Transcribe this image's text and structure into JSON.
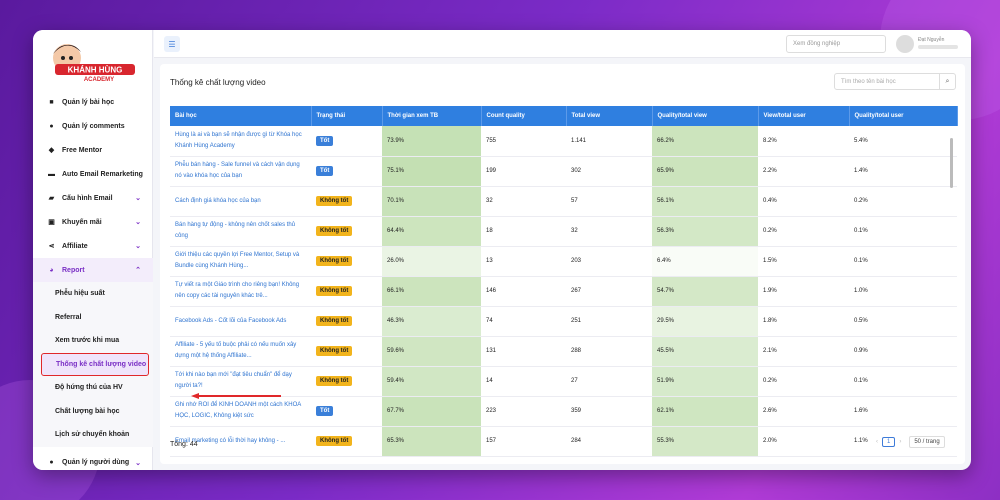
{
  "app": {
    "brand": "KHÁNH HÙNG ACADEMY"
  },
  "topbar": {
    "search_placeholder": "Xem đồng nghiệp",
    "user_name": "Đạt Nguyễn"
  },
  "sidebar": {
    "items": [
      {
        "label": "Quản lý bài học",
        "icon": "video-icon"
      },
      {
        "label": "Quản lý comments",
        "icon": "comment-icon"
      },
      {
        "label": "Free Mentor",
        "icon": "user-icon"
      },
      {
        "label": "Auto Email Remarketing",
        "icon": "mail-icon"
      },
      {
        "label": "Cấu hình Email",
        "icon": "car-icon"
      },
      {
        "label": "Khuyến mãi",
        "icon": "gift-icon"
      },
      {
        "label": "Affiliate",
        "icon": "share-icon"
      },
      {
        "label": "Report",
        "icon": "pie-icon"
      }
    ],
    "report_sub": [
      {
        "label": "Phễu hiệu suất"
      },
      {
        "label": "Referral"
      },
      {
        "label": "Xem trước khi mua"
      },
      {
        "label": "Thống kê chất lượng video"
      },
      {
        "label": "Độ hứng thú của HV"
      },
      {
        "label": "Chất lượng bài học"
      },
      {
        "label": "Lịch sử chuyển khoản"
      }
    ],
    "bottom": {
      "label": "Quản lý người dùng",
      "icon": "users-icon"
    }
  },
  "panel": {
    "title": "Thống kê chất lượng video",
    "search_placeholder": "Tìm theo tên bài học",
    "total": "Tổng: 44",
    "page": "1",
    "page_size": "50 / trang"
  },
  "table": {
    "headers": [
      "Bài học",
      "Trạng thái",
      "Thời gian xem TB",
      "Count quality",
      "Total view",
      "Quality/total view",
      "View/total user",
      "Quality/total user"
    ],
    "rows": [
      {
        "lesson": "Hùng là ai và bạn sẽ nhận được gì từ Khóa học Khánh Hùng Academy",
        "status": "Tốt",
        "good": true,
        "time": "73.9%",
        "count": "755",
        "views": "1.141",
        "qtv": "66.2%",
        "vtu": "8.2%",
        "qtu": "5.4%",
        "tshade": 0.74,
        "qshade": 0.66
      },
      {
        "lesson": "Phễu bán hàng - Sale funnel và cách vận dụng nó vào khóa học của bạn",
        "status": "Tốt",
        "good": true,
        "time": "75.1%",
        "count": "199",
        "views": "302",
        "qtv": "65.9%",
        "vtu": "2.2%",
        "qtu": "1.4%",
        "tshade": 0.75,
        "qshade": 0.66
      },
      {
        "lesson": "Cách định giá khóa học của bạn",
        "status": "Không tốt",
        "good": false,
        "time": "70.1%",
        "count": "32",
        "views": "57",
        "qtv": "56.1%",
        "vtu": "0.4%",
        "qtu": "0.2%",
        "tshade": 0.7,
        "qshade": 0.56
      },
      {
        "lesson": "Bán hàng tự động - không nên chốt sales thủ công",
        "status": "Không tốt",
        "good": false,
        "time": "64.4%",
        "count": "18",
        "views": "32",
        "qtv": "56.3%",
        "vtu": "0.2%",
        "qtu": "0.1%",
        "tshade": 0.64,
        "qshade": 0.56
      },
      {
        "lesson": "Giới thiệu các quyền lợi Free Mentor, Setup và Bundle cùng Khánh Hùng...",
        "status": "Không tốt",
        "good": false,
        "time": "26.0%",
        "count": "13",
        "views": "203",
        "qtv": "6.4%",
        "vtu": "1.5%",
        "qtu": "0.1%",
        "tshade": 0.26,
        "qshade": 0.06
      },
      {
        "lesson": "Tự viết ra một Giáo trình cho riêng bạn! Không nên copy các tài nguyên khác trê...",
        "status": "Không tốt",
        "good": false,
        "time": "66.1%",
        "count": "146",
        "views": "267",
        "qtv": "54.7%",
        "vtu": "1.9%",
        "qtu": "1.0%",
        "tshade": 0.66,
        "qshade": 0.55
      },
      {
        "lesson": "Facebook Ads - Cốt lõi của Facebook Ads",
        "status": "Không tốt",
        "good": false,
        "time": "46.3%",
        "count": "74",
        "views": "251",
        "qtv": "29.5%",
        "vtu": "1.8%",
        "qtu": "0.5%",
        "tshade": 0.46,
        "qshade": 0.3
      },
      {
        "lesson": "Affiliate - 5 yếu tố buộc phải có nếu muốn xây dựng một hệ thống Affiliate...",
        "status": "Không tốt",
        "good": false,
        "time": "59.6%",
        "count": "131",
        "views": "288",
        "qtv": "45.5%",
        "vtu": "2.1%",
        "qtu": "0.9%",
        "tshade": 0.6,
        "qshade": 0.46
      },
      {
        "lesson": "Tới khi nào bạn mới \"đạt tiêu chuẩn\" để dạy người ta?!",
        "status": "Không tốt",
        "good": false,
        "time": "59.4%",
        "count": "14",
        "views": "27",
        "qtv": "51.9%",
        "vtu": "0.2%",
        "qtu": "0.1%",
        "tshade": 0.59,
        "qshade": 0.52
      },
      {
        "lesson": "Ghi nhớ ROI để KINH DOANH một cách KHOA HỌC, LOGIC, Không kiệt sức",
        "status": "Tốt",
        "good": true,
        "time": "67.7%",
        "count": "223",
        "views": "359",
        "qtv": "62.1%",
        "vtu": "2.6%",
        "qtu": "1.6%",
        "tshade": 0.68,
        "qshade": 0.62
      },
      {
        "lesson": "Email marketing có lỗi thời hay không - ...",
        "status": "Không tốt",
        "good": false,
        "time": "65.3%",
        "count": "157",
        "views": "284",
        "qtv": "55.3%",
        "vtu": "2.0%",
        "qtu": "1.1%",
        "tshade": 0.65,
        "qshade": 0.55
      }
    ]
  },
  "colors": {
    "accent": "#7a2fc5",
    "header": "#2f7fe0",
    "good": "#3a7fd9",
    "bad": "#f2b41c",
    "shade": "#a9d18e",
    "highlight": "#e0282a"
  }
}
